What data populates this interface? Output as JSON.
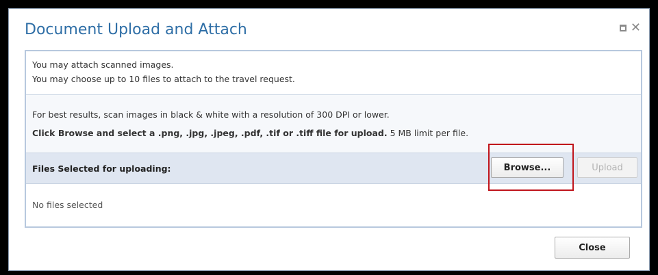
{
  "dialog": {
    "title": "Document Upload and Attach"
  },
  "info": {
    "line1": "You may attach scanned images.",
    "line2": "You may choose up to 10 files to attach to the travel request."
  },
  "instructions": {
    "line1": "For best results, scan images in black & white with a resolution of 300 DPI or lower.",
    "line2_bold": "Click Browse and select a .png, .jpg, .jpeg, .pdf, .tif or .tiff file for upload.",
    "line2_rest": " 5 MB limit per file."
  },
  "files": {
    "header_label": "Files Selected for uploading:",
    "empty_text": "No files selected"
  },
  "buttons": {
    "browse": "Browse...",
    "upload": "Upload",
    "close": "Close"
  },
  "icons": {
    "maximize": "maximize-icon",
    "close": "close-icon"
  },
  "colors": {
    "title": "#2e6ea6",
    "highlight": "#c0141b",
    "header_bg": "#dfe6f1"
  }
}
